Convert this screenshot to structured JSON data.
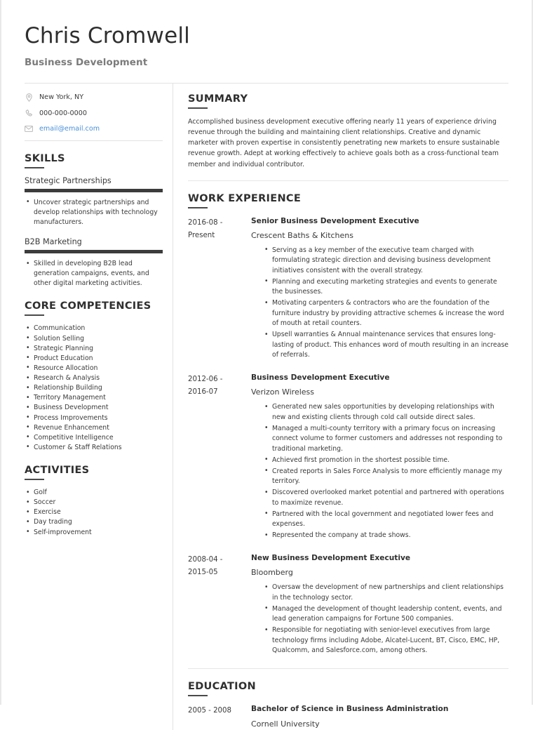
{
  "header": {
    "full_name": "Chris Cromwell",
    "job_title": "Business Development"
  },
  "contact": {
    "items": [
      {
        "icon": "location-pin-icon",
        "value": "New York, NY",
        "is_link": false
      },
      {
        "icon": "phone-icon",
        "value": "000-000-0000",
        "is_link": false
      },
      {
        "icon": "envelope-icon",
        "value": "email@email.com",
        "is_link": true
      }
    ],
    "link_color": "#4a90d9"
  },
  "sidebar": {
    "skills": {
      "heading": "SKILLS",
      "items": [
        {
          "name": "Strategic Partnerships",
          "level_percent": 100,
          "points": [
            "Uncover strategic partnerships and develop relationships with technology manufacturers."
          ]
        },
        {
          "name": "B2B Marketing",
          "level_percent": 100,
          "points": [
            "Skilled in developing B2B lead generation campaigns, events, and other digital marketing activities."
          ]
        }
      ]
    },
    "core_competencies": {
      "heading": "CORE COMPETENCIES",
      "items": [
        "Communication",
        "Solution Selling",
        "Strategic Planning",
        "Product Education",
        "Resource Allocation",
        "Research & Analysis",
        "Relationship Building",
        "Territory Management",
        "Business Development",
        "Process Improvements",
        "Revenue Enhancement",
        "Competitive Intelligence",
        "Customer & Staff Relations"
      ]
    },
    "activities": {
      "heading": "ACTIVITIES",
      "items": [
        "Golf",
        "Soccer",
        "Exercise",
        "Day trading",
        "Self-improvement"
      ]
    }
  },
  "main": {
    "summary": {
      "heading": "SUMMARY",
      "text": "Accomplished business development executive offering nearly 11 years of experience driving revenue through the building and maintaining client relationships. Creative and dynamic marketer with proven expertise in consistently penetrating new markets to ensure sustainable revenue growth. Adept at working effectively to achieve goals both as a cross-functional team member and individual contributor."
    },
    "work_experience": {
      "heading": "WORK EXPERIENCE",
      "jobs": [
        {
          "date_start": "2016-08 -",
          "date_end": "Present",
          "position": "Senior Business Development Executive",
          "employer": "Crescent Baths & Kitchens",
          "points": [
            "Serving as a key member of the executive team charged with formulating strategic direction and devising business development initiatives consistent with the overall strategy.",
            "Planning and executing marketing strategies and events to generate the businesses.",
            "Motivating carpenters & contractors who are the foundation of the furniture industry by providing attractive schemes & increase the word of mouth at retail counters.",
            "Upsell warranties & Annual maintenance services that ensures long-lasting of product. This enhances word of mouth resulting in an increase of referrals."
          ]
        },
        {
          "date_start": "2012-06 -",
          "date_end": "2016-07",
          "position": "Business Development Executive",
          "employer": "Verizon Wireless",
          "points": [
            "Generated new sales opportunities by developing relationships with new and existing clients through cold call outside direct sales.",
            "Managed a multi-county territory with a primary focus on increasing connect volume to former customers and addresses not responding to traditional marketing.",
            "Achieved first promotion in the shortest possible time.",
            "Created reports in Sales Force Analysis to more efficiently manage my territory.",
            "Discovered overlooked market potential and partnered with operations to maximize revenue.",
            "Partnered with the local government and negotiated lower fees and expenses.",
            "Represented the company at trade shows."
          ]
        },
        {
          "date_start": "2008-04 -",
          "date_end": "2015-05",
          "position": "New Business Development Executive",
          "employer": "Bloomberg",
          "points": [
            "Oversaw the development of new partnerships and client relationships in the technology sector.",
            "Managed the development of thought leadership content, events, and lead generation campaigns for Fortune 500 companies.",
            "Responsible for negotiating with senior-level executives from large technology firms including Adobe, Alcatel-Lucent, BT, Cisco, EMC, HP, Qualcomm, and Salesforce.com, among others."
          ]
        }
      ]
    },
    "education": {
      "heading": "EDUCATION",
      "entries": [
        {
          "dates": "2005 - 2008",
          "degree": "Bachelor of Science in Business Administration",
          "school": "Cornell University"
        }
      ]
    }
  }
}
